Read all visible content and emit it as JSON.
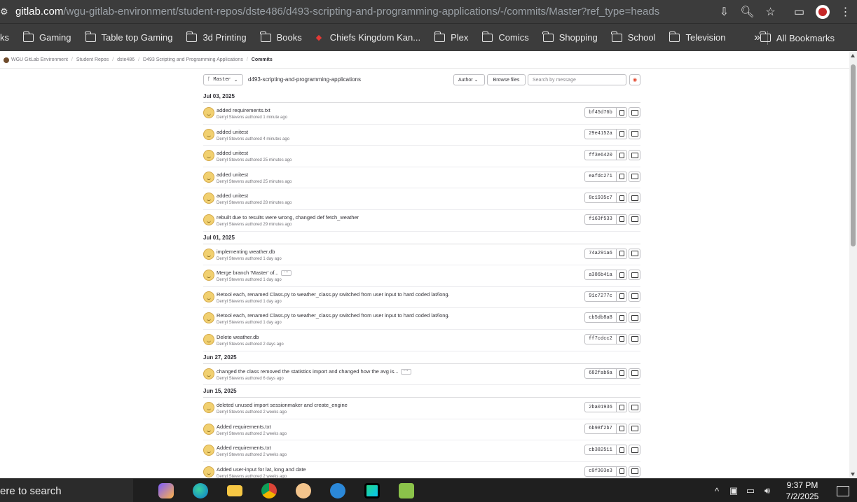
{
  "browser": {
    "url_host": "gitlab.com",
    "url_path": "/wgu-gitlab-environment/student-repos/dste486/d493-scripting-and-programming-applications/-/commits/Master?ref_type=heads"
  },
  "bookmarks": {
    "partial_first": "ks",
    "items": [
      "Gaming",
      "Table top Gaming",
      "3d Printing",
      "Books",
      "Chiefs Kingdom Kan...",
      "Plex",
      "Comics",
      "Shopping",
      "School",
      "Television"
    ],
    "more": "»",
    "all": "All Bookmarks"
  },
  "breadcrumb": [
    "WGU GitLab Environment",
    "Student Repos",
    "dste486",
    "D493 Scripting and Programming Applications",
    "Commits"
  ],
  "toolbar": {
    "branch": "Master",
    "repo_path": "d493-scripting-and-programming-applications",
    "author": "Author",
    "browse": "Browse files",
    "search_placeholder": "Search by message"
  },
  "groups": [
    {
      "date": "Jul 03, 2025",
      "commits": [
        {
          "title": "added requirements.txt",
          "meta": "Derryl Stevens authored 1 minute ago",
          "sha": "bf45d76b"
        },
        {
          "title": "added unitest",
          "meta": "Derryl Stevens authored 4 minutes ago",
          "sha": "29e4152a"
        },
        {
          "title": "added unitest",
          "meta": "Derryl Stevens authored 25 minutes ago",
          "sha": "ff3e6420"
        },
        {
          "title": "added unitest",
          "meta": "Derryl Stevens authored 25 minutes ago",
          "sha": "eafdc271"
        },
        {
          "title": "added unitest",
          "meta": "Derryl Stevens authored 28 minutes ago",
          "sha": "8c1935c7"
        },
        {
          "title": "rebuilt due to results were wrong, changed def fetch_weather",
          "meta": "Derryl Stevens authored 29 minutes ago",
          "sha": "f163f533"
        }
      ]
    },
    {
      "date": "Jul 01, 2025",
      "commits": [
        {
          "title": "implementing weather.db",
          "meta": "Derryl Stevens authored 1 day ago",
          "sha": "74a291a6"
        },
        {
          "title": "Merge branch 'Master' of...",
          "meta": "Derryl Stevens authored 1 day ago",
          "sha": "a386b41a",
          "ellipsis": true
        },
        {
          "title": "Retool each, renamed Class.py to weather_class.py switched from user input to hard coded lat/long.",
          "meta": "Derryl Stevens authored 1 day ago",
          "sha": "91c7277c"
        },
        {
          "title": "Retool each, renamed Class.py to weather_class.py switched from user input to hard coded lat/long.",
          "meta": "Derryl Stevens authored 1 day ago",
          "sha": "cb5db8a8"
        },
        {
          "title": "Delete weather.db",
          "meta": "Derryl Stevens authored 2 days ago",
          "sha": "ff7cdcc2"
        }
      ]
    },
    {
      "date": "Jun 27, 2025",
      "commits": [
        {
          "title": "changed the class removed the statistics import and changed how the avg is...",
          "meta": "Derryl Stevens authored 6 days ago",
          "sha": "682fab6a",
          "ellipsis": true
        }
      ]
    },
    {
      "date": "Jun 15, 2025",
      "commits": [
        {
          "title": "deleted unused import sessionmaker and create_engine",
          "meta": "Derryl Stevens authored 2 weeks ago",
          "sha": "2ba01936"
        },
        {
          "title": "Added requirements.txt",
          "meta": "Derryl Stevens authored 2 weeks ago",
          "sha": "6b98f2b7"
        },
        {
          "title": "Added requirements.txt",
          "meta": "Derryl Stevens authored 2 weeks ago",
          "sha": "cb382511"
        },
        {
          "title": "Added user-input for lat, long and date",
          "meta": "Derryl Stevens authored 2 weeks ago",
          "sha": "c0f303e3"
        }
      ]
    }
  ],
  "taskbar": {
    "search": "ere to search",
    "time": "9:37 PM",
    "date": "7/2/2025"
  },
  "colors": {
    "chrome_bg": "#3c3c3c",
    "taskbar_bg": "#1f1f1f",
    "avatar": "#f1d070"
  }
}
